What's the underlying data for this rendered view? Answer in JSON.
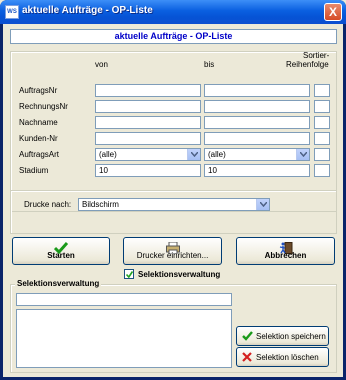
{
  "window": {
    "app_icon_text": "WS",
    "title": "aktuelle Aufträge - OP-Liste",
    "close_label": "X"
  },
  "header": {
    "title": "aktuelle Aufträge  -  OP-Liste"
  },
  "columns": {
    "from": "von",
    "to": "bis",
    "sort_line1": "Sortier-",
    "sort_line2": "Reihenfolge"
  },
  "fields": [
    {
      "label": "AuftragsNr",
      "from": "",
      "to": "",
      "sort": ""
    },
    {
      "label": "RechnungsNr",
      "from": "",
      "to": "",
      "sort": ""
    },
    {
      "label": "Nachname",
      "from": "",
      "to": "",
      "sort": ""
    },
    {
      "label": "Kunden-Nr",
      "from": "",
      "to": "",
      "sort": ""
    },
    {
      "label": "AuftragsArt",
      "from": "(alle)",
      "to": "(alle)",
      "sort": ""
    },
    {
      "label": "Stadium",
      "from": "10",
      "to": "10",
      "sort": ""
    }
  ],
  "print": {
    "label": "Drucke nach:",
    "value": "Bildschirm"
  },
  "buttons": {
    "start": "Starten",
    "printer": "Drucker einrichten...",
    "cancel": "Abbrechen"
  },
  "selection": {
    "checkbox_label": "Selektionsverwaltung",
    "checked": true,
    "group_title": "Selektionsverwaltung",
    "name_value": "",
    "save": "Selektion speichern",
    "delete": "Selektion löschen"
  },
  "colors": {
    "title_blue": "#0000c8",
    "accent_green": "#1a9a1a",
    "delete_red": "#d42020"
  }
}
